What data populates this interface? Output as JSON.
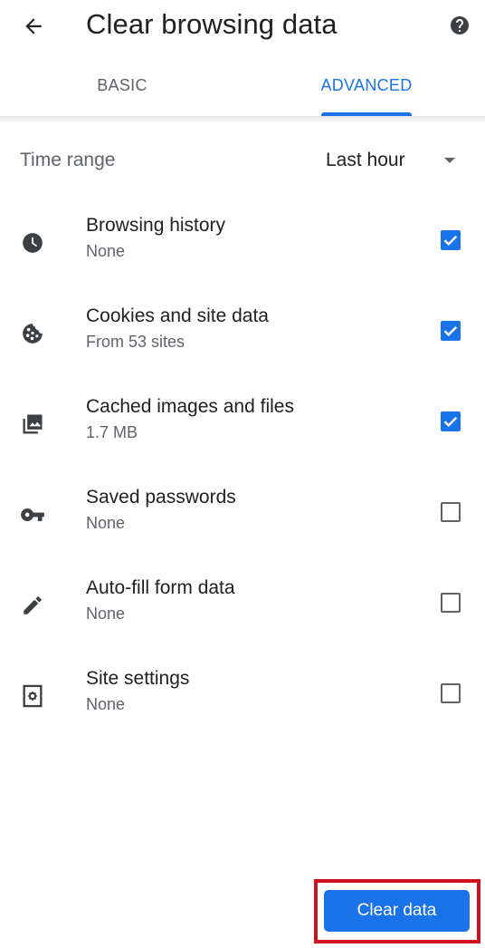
{
  "header": {
    "title": "Clear browsing data",
    "back_icon": "arrow-back-icon",
    "help_icon": "help-icon"
  },
  "tabs": [
    {
      "label": "BASIC",
      "selected": false
    },
    {
      "label": "ADVANCED",
      "selected": true
    }
  ],
  "time_range": {
    "label": "Time range",
    "value": "Last hour"
  },
  "items": [
    {
      "title": "Browsing history",
      "subtitle": "None",
      "icon": "history-clock-icon",
      "checked": true
    },
    {
      "title": "Cookies and site data",
      "subtitle": "From 53 sites",
      "icon": "cookie-icon",
      "checked": true
    },
    {
      "title": "Cached images and files",
      "subtitle": "1.7 MB",
      "icon": "images-icon",
      "checked": true
    },
    {
      "title": "Saved passwords",
      "subtitle": "None",
      "icon": "key-icon",
      "checked": false
    },
    {
      "title": "Auto-fill form data",
      "subtitle": "None",
      "icon": "pencil-icon",
      "checked": false
    },
    {
      "title": "Site settings",
      "subtitle": "None",
      "icon": "site-settings-icon",
      "checked": false
    }
  ],
  "footer": {
    "clear_button_label": "Clear data"
  },
  "colors": {
    "accent": "#1a73e8",
    "annotation": "#d0121f",
    "text_primary": "#202124",
    "text_secondary": "#5f6368"
  }
}
